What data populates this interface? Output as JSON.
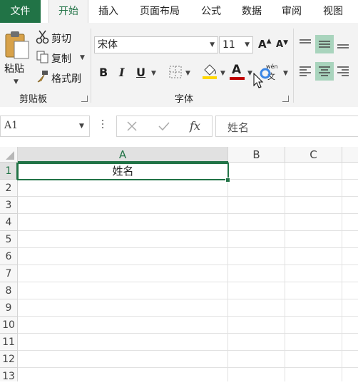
{
  "tabs": {
    "file": "文件",
    "home": "开始",
    "insert": "插入",
    "layout": "页面布局",
    "formulas": "公式",
    "data": "数据",
    "review": "审阅",
    "view": "视图"
  },
  "clipboard": {
    "paste": "粘贴",
    "cut": "剪切",
    "copy": "复制",
    "format_painter": "格式刷",
    "group_label": "剪贴板"
  },
  "font": {
    "name": "宋体",
    "size": "11",
    "bold": "B",
    "italic": "I",
    "underline": "U",
    "grow": "A",
    "shrink": "A",
    "color_letter": "A",
    "phonetic_top": "wén",
    "phonetic_bottom": "文",
    "group_label": "字体"
  },
  "formula_bar": {
    "name_box": "A1",
    "fx": "fx",
    "content": "姓名"
  },
  "grid": {
    "columns": [
      "A",
      "B",
      "C"
    ],
    "rows": [
      "1",
      "2",
      "3",
      "4",
      "5",
      "6",
      "7",
      "8",
      "9",
      "10",
      "11",
      "12",
      "13"
    ],
    "a1_value": "姓名"
  },
  "colors": {
    "accent": "#217346",
    "align_active": "#a9d4bd",
    "highlight_yellow": "#ffd700",
    "font_red": "#c00000"
  }
}
